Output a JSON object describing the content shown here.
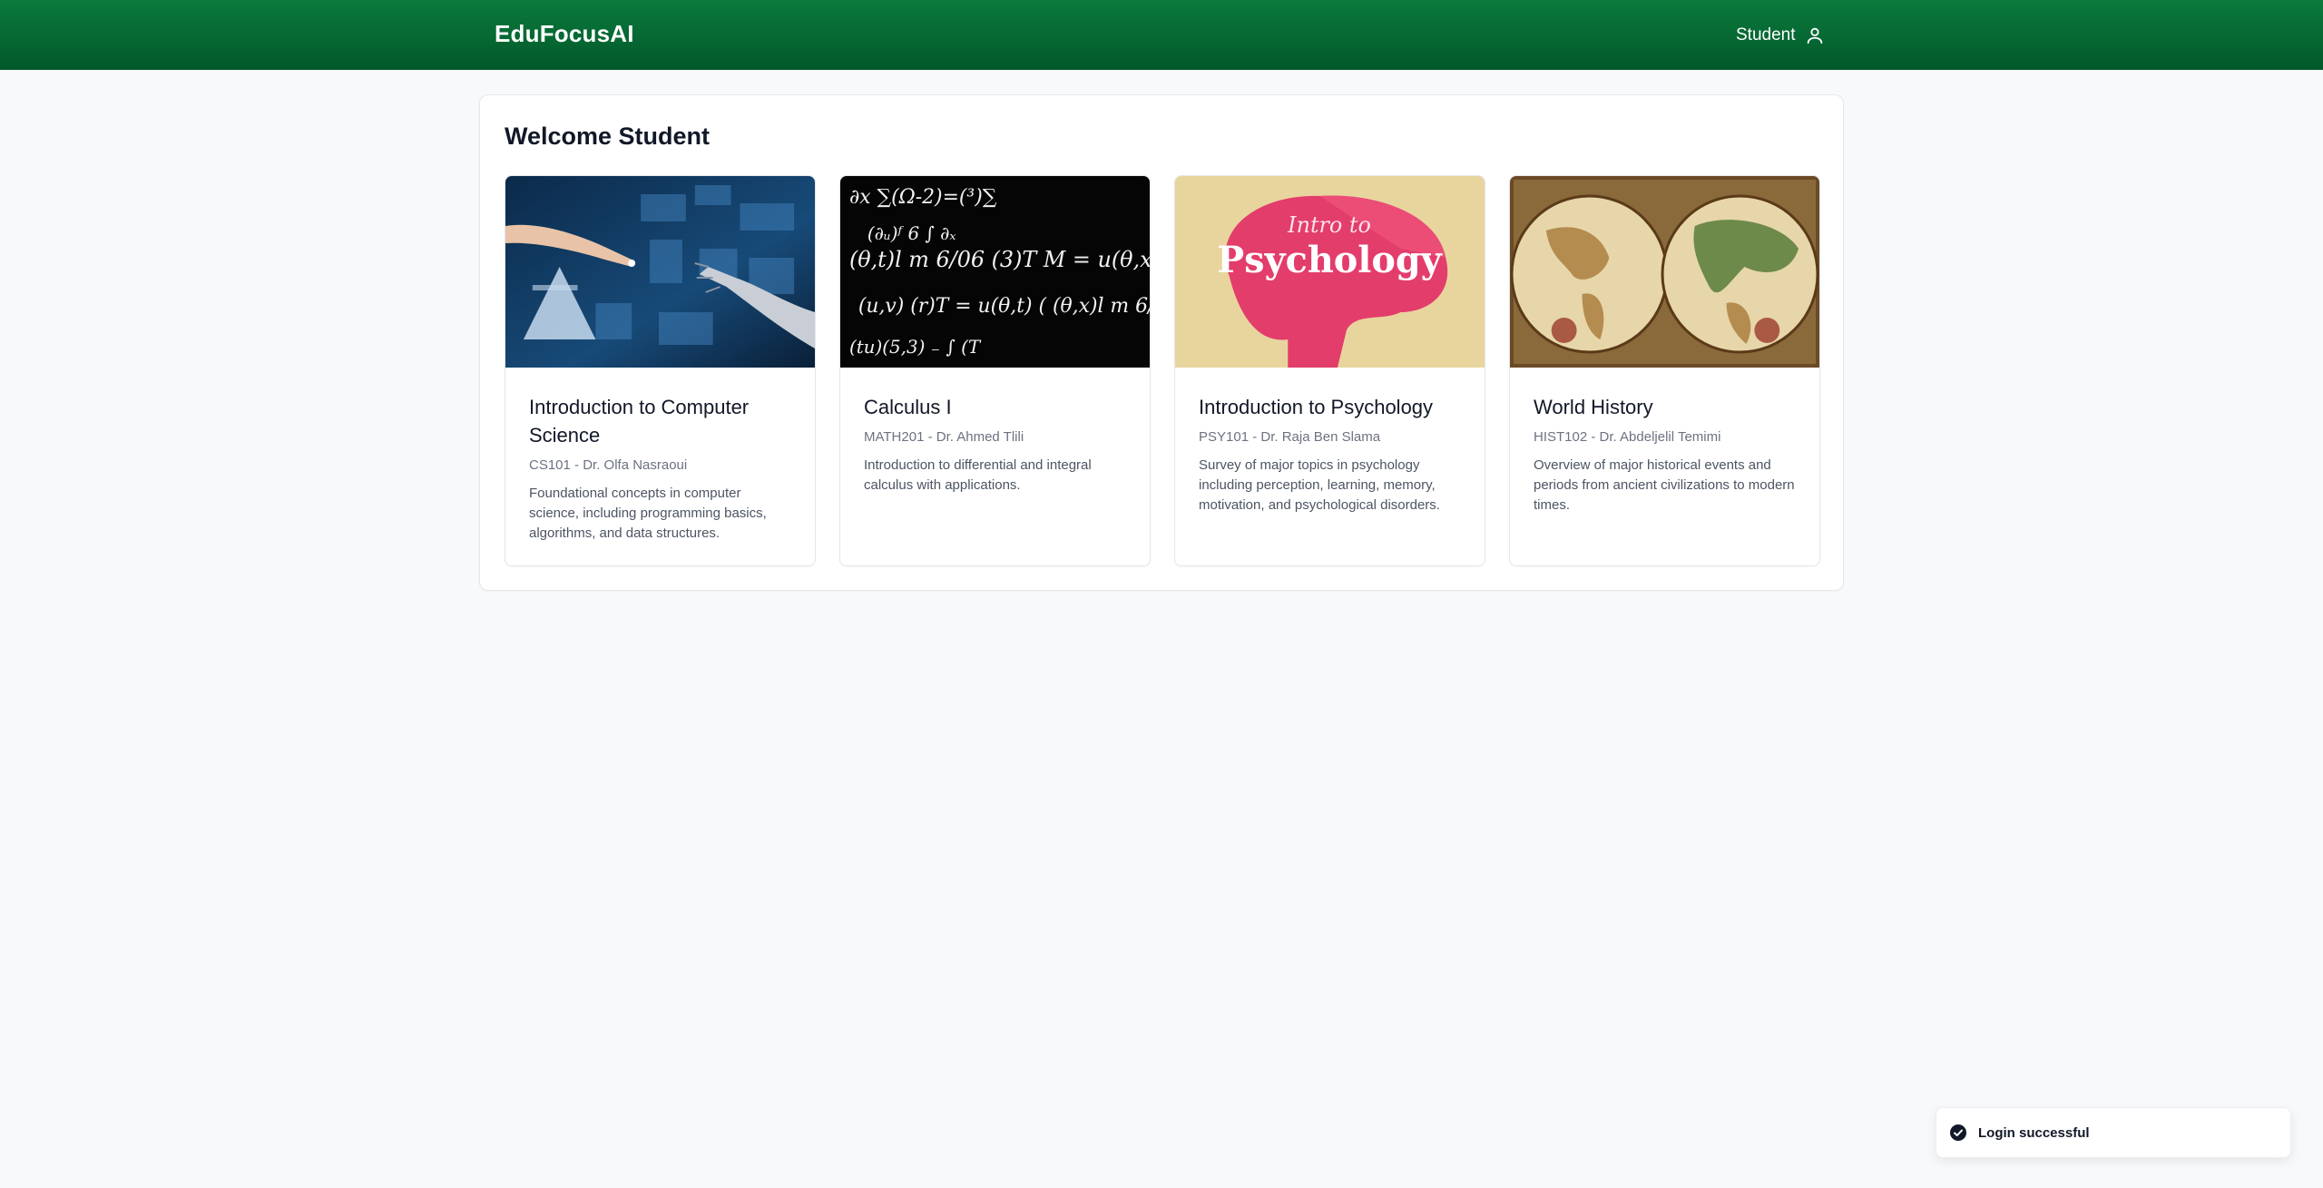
{
  "app": {
    "brand": "EduFocusAI",
    "user_label": "Student"
  },
  "main": {
    "heading": "Welcome Student"
  },
  "courses": [
    {
      "title": "Introduction to Computer Science",
      "meta": "CS101 - Dr. Olfa Nasraoui",
      "description": "Foundational concepts in computer science, including programming basics, algorithms, and data structures.",
      "image_label": "robot-hand-touching-screen"
    },
    {
      "title": "Calculus I",
      "meta": "MATH201 - Dr. Ahmed Tlili",
      "description": "Introduction to differential and integral calculus with applications.",
      "image_label": "chalkboard-equations"
    },
    {
      "title": "Introduction to Psychology",
      "meta": "PSY101 - Dr. Raja Ben Slama",
      "description": "Survey of major topics in psychology including perception, learning, memory, motivation, and psychological disorders.",
      "image_label": "pink-brain-banner",
      "image_text": {
        "line1": "Intro to",
        "line2": "Psychology"
      }
    },
    {
      "title": "World History",
      "meta": "HIST102 - Dr. Abdeljelil Temimi",
      "description": "Overview of major historical events and periods from ancient civilizations to modern times.",
      "image_label": "antique-world-map"
    }
  ],
  "toast": {
    "message": "Login successful",
    "icon": "check-circle-icon"
  },
  "colors": {
    "header_top": "#0a7a3c",
    "header_bottom": "#02592b",
    "background": "#f8f9fb"
  }
}
